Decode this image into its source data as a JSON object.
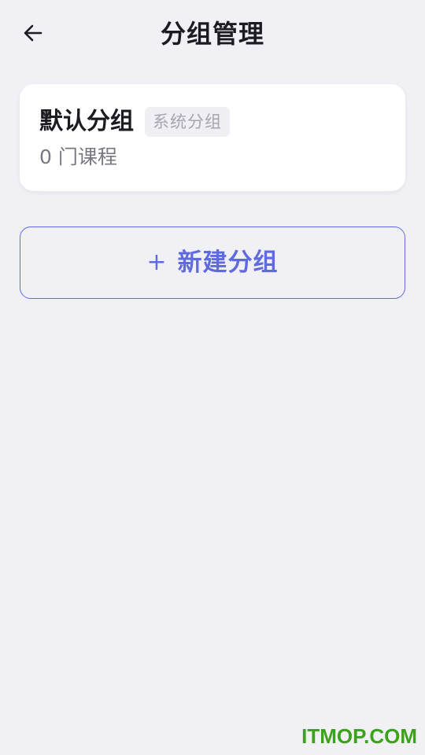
{
  "header": {
    "back_icon": "arrow-left-icon",
    "title": "分组管理"
  },
  "groups": [
    {
      "name": "默认分组",
      "badge": "系统分组",
      "course_count": "0 门课程"
    }
  ],
  "actions": {
    "new_group_icon": "plus-icon",
    "new_group_label": "新建分组"
  },
  "watermark": "ITMOP.COM",
  "colors": {
    "background": "#f1f0f5",
    "card": "#ffffff",
    "accent": "#5f6ade",
    "badge_bg": "#efeff4",
    "badge_text": "#a6a5b0",
    "watermark": "#3aa31a"
  }
}
